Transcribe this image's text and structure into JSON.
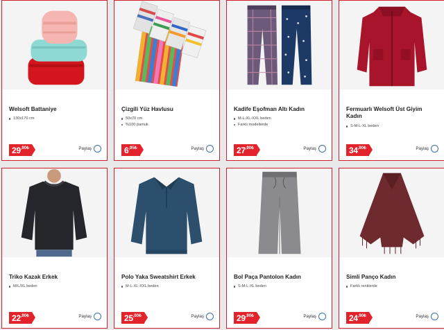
{
  "products": [
    {
      "title": "Welsoft Battaniye",
      "features": [
        "130x170 cm"
      ],
      "price_int": "29",
      "price_dec": ",90",
      "currency": "₺",
      "share_label": "Paylaş",
      "image_icon": "blanket-stack-image"
    },
    {
      "title": "Çizgili Yüz Havlusu",
      "features": [
        "50x70 cm",
        "%100 pamuk"
      ],
      "price_int": "6",
      "price_dec": ",95",
      "currency": "₺",
      "share_label": "Paylaş",
      "image_icon": "striped-towels-image"
    },
    {
      "title": "Kadife Eşofman Altı Kadın",
      "features": [
        "M-L-XL-XXL beden",
        "Farklı modellerde"
      ],
      "price_int": "27",
      "price_dec": ",90",
      "currency": "₺",
      "share_label": "Paylaş",
      "image_icon": "pajama-pants-image"
    },
    {
      "title": "Fermuarlı Welsoft Üst Giyim Kadın",
      "features": [
        "S-M-L-XL beden"
      ],
      "price_int": "34",
      "price_dec": ",90",
      "currency": "₺",
      "share_label": "Paylaş",
      "image_icon": "zip-fleece-jacket-image"
    },
    {
      "title": "Triko Kazak Erkek",
      "features": [
        "M/L/XL beden"
      ],
      "price_int": "22",
      "price_dec": ",90",
      "currency": "₺",
      "share_label": "Paylaş",
      "image_icon": "knit-sweater-image"
    },
    {
      "title": "Polo Yaka Sweatshirt Erkek",
      "features": [
        "M-L-XL-XXL beden"
      ],
      "price_int": "25",
      "price_dec": ",00",
      "currency": "₺",
      "share_label": "Paylaş",
      "image_icon": "polo-sweatshirt-image"
    },
    {
      "title": "Bol Paça Pantolon Kadın",
      "features": [
        "S-M-L-XL beden"
      ],
      "price_int": "29",
      "price_dec": ",90",
      "currency": "₺",
      "share_label": "Paylaş",
      "image_icon": "wide-leg-pants-image"
    },
    {
      "title": "Simli Panço Kadın",
      "features": [
        "Farklı renklerde"
      ],
      "price_int": "24",
      "price_dec": ",90",
      "currency": "₺",
      "share_label": "Paylaş",
      "image_icon": "poncho-image"
    }
  ],
  "colors": {
    "border": "#d21e2b",
    "price_bg": "#e3232c",
    "share_circle": "#3a6fa6"
  }
}
